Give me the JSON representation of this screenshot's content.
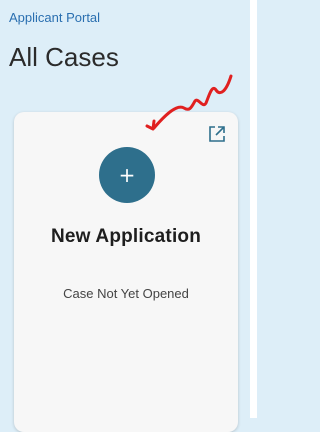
{
  "header": {
    "portal_link": "Applicant Portal",
    "title": "All Cases"
  },
  "card": {
    "add_button_symbol": "+",
    "title": "New Application",
    "status": "Case Not Yet Opened",
    "icons": {
      "add": "plus-icon",
      "external": "external-link-icon"
    }
  },
  "colors": {
    "background": "#ddeef8",
    "link": "#2a6fb0",
    "add_button": "#2e6f8c",
    "external_icon": "#2e6f8c",
    "annotation_arrow": "#e02020"
  }
}
